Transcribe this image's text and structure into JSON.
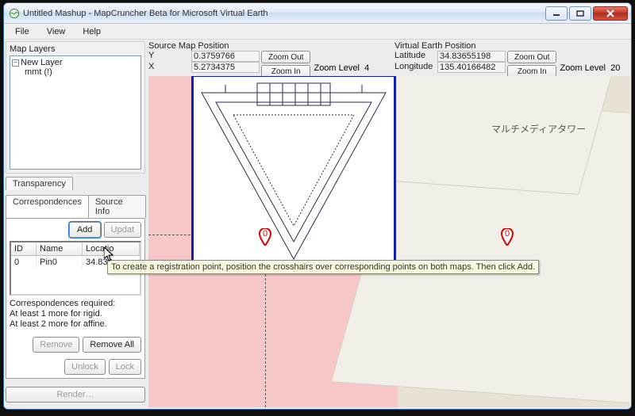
{
  "window": {
    "title": "Untitled Mashup - MapCruncher Beta for Microsoft Virtual Earth"
  },
  "menu": {
    "file": "File",
    "view": "View",
    "help": "Help"
  },
  "sidebar": {
    "map_layers_title": "Map Layers",
    "tree": {
      "root": "New Layer",
      "child": "mmt (!)"
    },
    "tab_transparency": "Transparency",
    "tab_correspondences": "Correspondences",
    "tab_sourceinfo": "Source Info",
    "add": "Add",
    "update": "Updat",
    "table_headers": {
      "id": "ID",
      "name": "Name",
      "loc": "Locatio"
    },
    "rows": [
      {
        "id": "0",
        "name": "Pin0",
        "loc": "34.836…"
      }
    ],
    "req_title": "Correspondences required:",
    "req_line1": "At least 1 more for rigid.",
    "req_line2": "At least 2 more for affine.",
    "remove": "Remove",
    "removeall": "Remove All",
    "unlock": "Unlock",
    "lock": "Lock",
    "render": "Render…"
  },
  "source_pos": {
    "title": "Source Map Position",
    "y_label": "Y",
    "y": "0.3759766",
    "x_label": "X",
    "x": "5.2734375",
    "zoomlevel_label": "Zoom Level",
    "zoomlevel": "4",
    "zoomout": "Zoom Out",
    "zoomin": "Zoom In"
  },
  "ve_pos": {
    "title": "Virtual Earth Position",
    "lat_label": "Latitude",
    "lat": "34.83655198",
    "lon_label": "Longitude",
    "lon": "135.40166482",
    "zoomlevel_label": "Zoom Level",
    "zoomlevel": "20",
    "zoomout": "Zoom Out",
    "zoomin": "Zoom In"
  },
  "tooltip": "To create a registration point, position the crosshairs over corresponding points on both maps.  Then click Add.",
  "ve_label": "マルチメディアタワー",
  "marker0": "0",
  "marker1": "0"
}
